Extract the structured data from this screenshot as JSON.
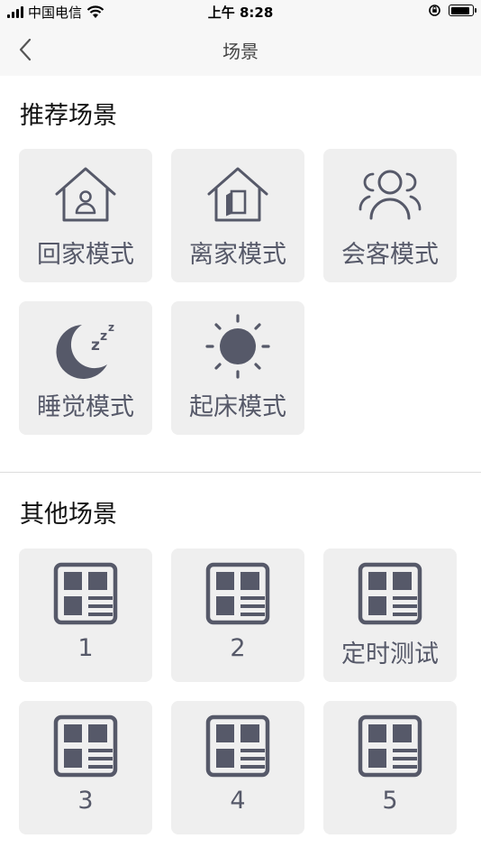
{
  "status_bar": {
    "carrier": "中国电信",
    "time": "上午 8:28",
    "battery_level": 0.9
  },
  "nav": {
    "title": "场景"
  },
  "recommended": {
    "title": "推荐场景",
    "items": [
      {
        "label": "回家模式",
        "icon": "home-person-icon"
      },
      {
        "label": "离家模式",
        "icon": "home-door-icon"
      },
      {
        "label": "会客模式",
        "icon": "guests-icon"
      },
      {
        "label": "睡觉模式",
        "icon": "moon-sleep-icon"
      },
      {
        "label": "起床模式",
        "icon": "sun-icon"
      }
    ]
  },
  "other": {
    "title": "其他场景",
    "items": [
      {
        "label": "1",
        "icon": "scene-grid-icon"
      },
      {
        "label": "2",
        "icon": "scene-grid-icon"
      },
      {
        "label": "定时测试",
        "icon": "scene-grid-icon"
      },
      {
        "label": "3",
        "icon": "scene-grid-icon"
      },
      {
        "label": "4",
        "icon": "scene-grid-icon"
      },
      {
        "label": "5",
        "icon": "scene-grid-icon"
      }
    ]
  },
  "colors": {
    "icon": "#565969",
    "tile_bg": "#efefef",
    "bar_bg": "#f7f7f7"
  }
}
